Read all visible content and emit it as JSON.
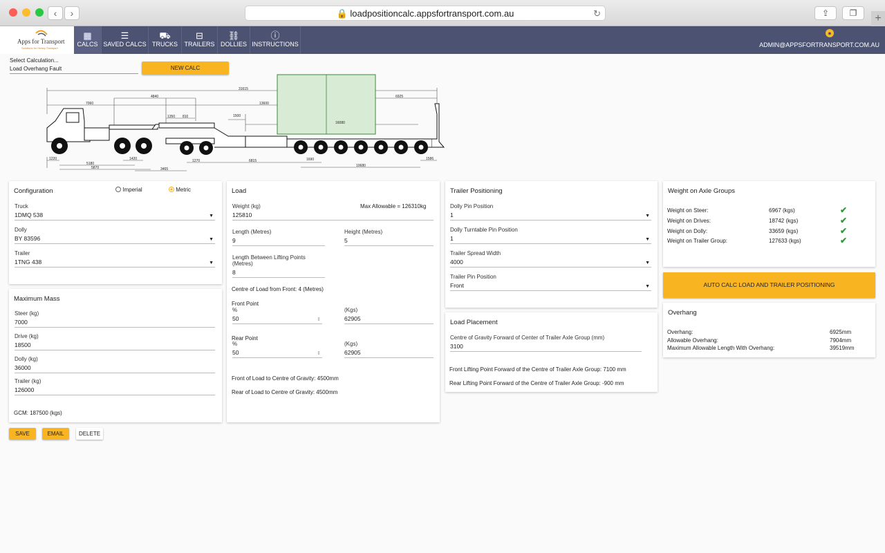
{
  "browser": {
    "url": "loadpositioncalc.appsfortransport.com.au"
  },
  "brand": {
    "name": "Apps for Transport",
    "tagline": "Solutions for Heavy Transport"
  },
  "nav": [
    {
      "label": "CALCS",
      "icon": "calculator-icon",
      "glyph": "▦"
    },
    {
      "label": "SAVED CALCS",
      "icon": "list-icon",
      "glyph": "☰"
    },
    {
      "label": "TRUCKS",
      "icon": "truck-icon",
      "glyph": "⛟"
    },
    {
      "label": "TRAILERS",
      "icon": "trailer-icon",
      "glyph": "⊟"
    },
    {
      "label": "DOLLIES",
      "icon": "link-icon",
      "glyph": "⛓"
    },
    {
      "label": "INSTRUCTIONS",
      "icon": "info-icon",
      "glyph": "ⓘ"
    }
  ],
  "user": {
    "email": "ADMIN@APPSFORTRANSPORT.COM.AU"
  },
  "select_calc": {
    "label": "Select Calculation...",
    "value": "Load Overhang Fault"
  },
  "new_calc_label": "NEW CALC",
  "diagram": {
    "dims": {
      "overall": "31615",
      "d4840": "4840",
      "d7060": "7060",
      "d13600": "13600",
      "d6925": "6925",
      "d1350": "1350",
      "d810": "810",
      "d1500": "1500",
      "d16080": "16080",
      "d1220": "1220",
      "d5180": "5180",
      "d1420": "1420",
      "d5870": "5870",
      "d3465": "3465",
      "d1270": "1270",
      "d6815": "6815",
      "d1690": "1690",
      "d10680": "10680",
      "d1586": "1586"
    }
  },
  "configuration": {
    "title": "Configuration",
    "imperial": "Imperial",
    "metric": "Metric",
    "truck_label": "Truck",
    "truck": "1DMQ 538",
    "dolly_label": "Dolly",
    "dolly": "BY 83596",
    "trailer_label": "Trailer",
    "trailer": "1TNG 438"
  },
  "max_mass": {
    "title": "Maximum Mass",
    "steer_label": "Steer (kg)",
    "steer": "7000",
    "drive_label": "Drive (kg)",
    "drive": "18500",
    "dolly_label": "Dolly (kg)",
    "dolly": "36000",
    "trailer_label": "Trailer (kg)",
    "trailer": "126000",
    "gcm": "GCM: 187500 (kgs)"
  },
  "load": {
    "title": "Load",
    "weight_label": "Weight (kg)",
    "weight": "125810",
    "max_allowable": "Max Allowable = 126310kg",
    "length_label": "Length (Metres)",
    "length": "9",
    "height_label": "Height (Metres)",
    "height": "5",
    "lbl_label": "Length Between Lifting Points (Metres)",
    "lbl": "8",
    "centre": "Centre of Load from Front: 4 (Metres)",
    "front_point": "Front Point",
    "pct": "%",
    "front_pct": "50",
    "kgs": "(Kgs)",
    "front_kgs": "62905",
    "rear_point": "Rear Point",
    "rear_pct": "50",
    "rear_kgs": "62905",
    "front_cog": "Front of Load to Centre of Gravity: 4500mm",
    "rear_cog": "Rear of Load to Centre of Gravity: 4500mm"
  },
  "trailer_pos": {
    "title": "Trailer Positioning",
    "dpp_label": "Dolly Pin Position",
    "dpp": "1",
    "dtpp_label": "Dolly Turntable Pin Position",
    "dtpp": "1",
    "tsw_label": "Trailer Spread Width",
    "tsw": "4000",
    "tpp_label": "Trailer Pin Position",
    "tpp": "Front"
  },
  "load_placement": {
    "title": "Load Placement",
    "cog_label": "Centre of Gravity Forward of Center of Trailer Axle Group (mm)",
    "cog": "3100",
    "front_lift": "Front Lifting Point Forward of the Centre of Trailer Axle Group: 7100 mm",
    "rear_lift": "Rear Lifting Point Forward of the Centre of Trailer Axle Group: -900 mm"
  },
  "axle_weights": {
    "title": "Weight on Axle Groups",
    "rows": [
      {
        "label": "Weight on Steer:",
        "value": "6967 (kgs)"
      },
      {
        "label": "Weight on Drives:",
        "value": "18742 (kgs)"
      },
      {
        "label": "Weight on Dolly:",
        "value": "33659 (kgs)"
      },
      {
        "label": "Weight on Trailer Group:",
        "value": "127633 (kgs)"
      }
    ]
  },
  "auto_calc_label": "AUTO CALC LOAD AND TRAILER POSITIONING",
  "overhang": {
    "title": "Overhang",
    "rows": [
      {
        "label": "Overhang:",
        "value": "6925mm"
      },
      {
        "label": "Allowable Overhang:",
        "value": "7904mm"
      },
      {
        "label": "Maximum Allowable Length With Overhang:",
        "value": "39519mm"
      }
    ]
  },
  "actions": {
    "save": "SAVE",
    "email": "EMAIL",
    "delete": "DELETE"
  }
}
